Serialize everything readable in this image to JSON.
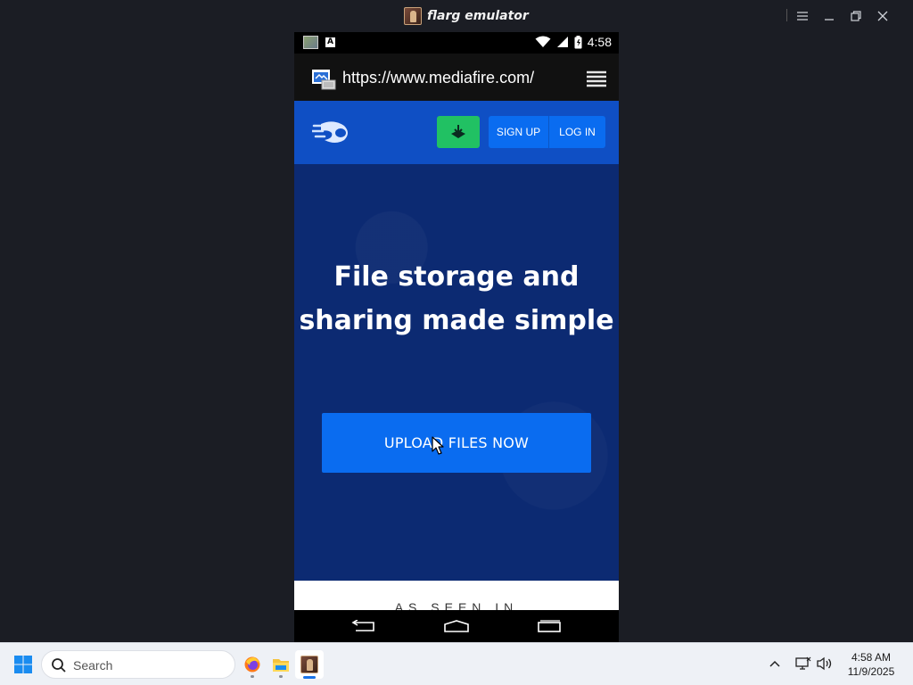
{
  "window": {
    "title": "flarg emulator",
    "icons": [
      "app-icon",
      "hamburger-icon",
      "minimize-icon",
      "restore-icon",
      "close-icon"
    ]
  },
  "phone": {
    "status_bar": {
      "time": "4:58",
      "icons": [
        "gallery-notification-icon",
        "a-notification-icon",
        "wifi-icon",
        "signal-icon",
        "battery-icon"
      ]
    },
    "browser": {
      "url": "https://www.mediafire.com/",
      "icons": [
        "browser-icon",
        "menu-icon"
      ]
    },
    "site": {
      "header": {
        "logo": "mediafire-logo",
        "download_icon": "download-icon",
        "signup_label": "SIGN UP",
        "login_label": "LOG IN"
      },
      "hero": {
        "title_line1": "File storage and",
        "title_line2": "sharing made simple",
        "upload_label": "UPLOAD FILES NOW"
      },
      "seen_in_label": "AS SEEN IN"
    },
    "nav_bar": {
      "icons": [
        "back-icon",
        "home-icon",
        "recents-icon"
      ]
    }
  },
  "taskbar": {
    "search_placeholder": "Search",
    "apps": [
      "windows-start-icon",
      "firefox-icon",
      "file-explorer-icon",
      "flarg-emulator-icon"
    ],
    "tray_icons": [
      "chevron-up-icon",
      "network-icon",
      "volume-icon"
    ],
    "clock_time": "4:58 AM",
    "clock_date": "11/9/2025"
  },
  "colors": {
    "mediafire_blue": "#0f4fc4",
    "hero_navy": "#0c2a72",
    "button_blue": "#0a6cf0",
    "download_green": "#21c163"
  }
}
